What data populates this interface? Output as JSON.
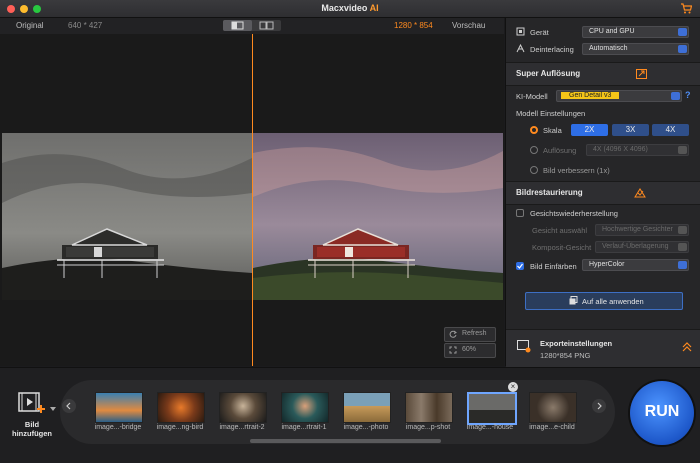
{
  "window": {
    "title": "Macxvideo",
    "title_suffix": "AI"
  },
  "viewer": {
    "original_label": "Original",
    "original_dims": "640 * 427",
    "output_dims": "1280 * 854",
    "preview_label": "Vorschau",
    "refresh_label": "Refresh",
    "zoom_label": "60%"
  },
  "panel": {
    "device_label": "Gerät",
    "device_value": "CPU and GPU",
    "deinterlacing_label": "Deinterlacing",
    "deinterlacing_value": "Automatisch",
    "super_title": "Super Auflösung",
    "ki_label": "KI-Modell",
    "ki_value": "Gen Detail v3",
    "help": "?",
    "model_settings": "Modell Einstellungen",
    "scale_label": "Skala",
    "scale_options": [
      "2X",
      "3X",
      "4X"
    ],
    "scale_selected": "2X",
    "resolution_label": "Auflösung",
    "resolution_value": "4X (4096 X 4096)",
    "improve_label": "Bild verbessern (1x)",
    "restoration_title": "Bildrestaurierung",
    "face_label": "Gesichtswiederherstellung",
    "face_select_label": "Gesicht auswähl",
    "face_select_value": "Hochwertige Gesichter",
    "composite_label": "Komposit-Gesicht",
    "composite_value": "Verlauf-Überlagerung",
    "colorize_label": "Bild Einfärben",
    "colorize_value": "HyperColor",
    "apply_all": "Auf alle anwenden",
    "export_title": "Exporteinstellungen",
    "export_detail": "1280*854 PNG"
  },
  "bottom": {
    "add_label_1": "Bild",
    "add_label_2": "hinzufügen",
    "run_label": "RUN",
    "thumbnails": [
      {
        "label": "image...-bridge"
      },
      {
        "label": "image...ng-bird"
      },
      {
        "label": "image...rtrait-2"
      },
      {
        "label": "image...rtrait-1"
      },
      {
        "label": "image...-photo"
      },
      {
        "label": "image...p-shot"
      },
      {
        "label": "image...-house",
        "selected": true
      },
      {
        "label": "image...e-child"
      }
    ]
  },
  "colors": {
    "accent": "#ff8a1f",
    "primary": "#2e6ee6",
    "ki_highlight": "#f5c518"
  }
}
